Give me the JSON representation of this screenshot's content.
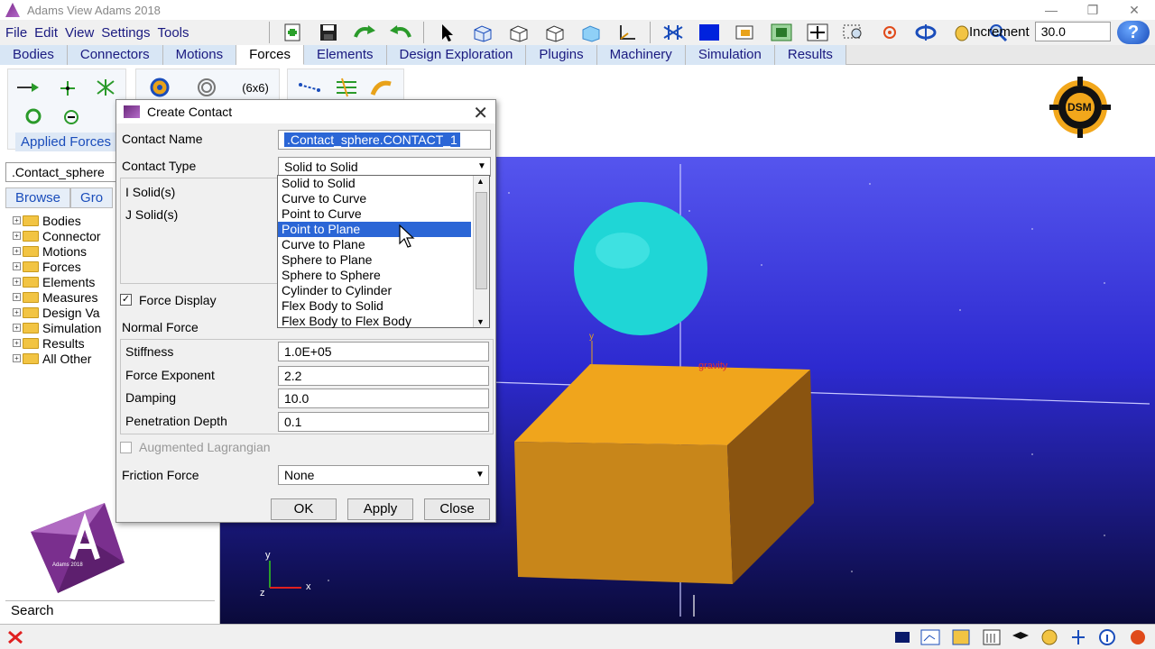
{
  "window": {
    "title": "Adams View Adams 2018"
  },
  "menu": [
    "File",
    "Edit",
    "View",
    "Settings",
    "Tools"
  ],
  "toolbar": {
    "increment_label": "Increment",
    "increment_value": "30.0"
  },
  "tabs": [
    "Bodies",
    "Connectors",
    "Motions",
    "Forces",
    "Elements",
    "Design Exploration",
    "Plugins",
    "Machinery",
    "Simulation",
    "Results"
  ],
  "active_tab": "Forces",
  "ribbon": {
    "applied_forces_label": "Applied Forces",
    "matrix_label": "(6x6)"
  },
  "browser": {
    "model_field": ".Contact_sphere",
    "tabs": [
      "Browse",
      "Gro"
    ],
    "tree": [
      "Bodies",
      "Connector",
      "Motions",
      "Forces",
      "Elements",
      "Measures",
      "Design Va",
      "Simulation",
      "Results",
      "All Other"
    ],
    "search_label": "Search",
    "badge_text": "Adams 2018"
  },
  "dialog": {
    "title": "Create Contact",
    "contact_name_label": "Contact Name",
    "contact_name_value": ".Contact_sphere.CONTACT_1",
    "contact_type_label": "Contact Type",
    "contact_type_value": "Solid to Solid",
    "i_solid_label": "I Solid(s)",
    "j_solid_label": "J Solid(s)",
    "force_display_label": "Force Display",
    "normal_force_label": "Normal Force",
    "stiffness_label": "Stiffness",
    "stiffness_value": "1.0E+05",
    "force_exponent_label": "Force Exponent",
    "force_exponent_value": "2.2",
    "damping_label": "Damping",
    "damping_value": "10.0",
    "penetration_label": "Penetration Depth",
    "penetration_value": "0.1",
    "augmented_label": "Augmented Lagrangian",
    "friction_label": "Friction Force",
    "friction_value": "None",
    "ok_label": "OK",
    "apply_label": "Apply",
    "close_label": "Close"
  },
  "dropdown": {
    "options": [
      "Solid to Solid",
      "Curve to Curve",
      "Point to Curve",
      "Point to Plane",
      "Curve to Plane",
      "Sphere to Plane",
      "Sphere to Sphere",
      "Cylinder to Cylinder",
      "Flex Body to Solid",
      "Flex Body to Flex Body"
    ],
    "highlighted": "Point to Plane"
  },
  "viewport": {
    "gravity_label": "gravity",
    "axis_y": "y",
    "axis_x": "x",
    "axis_z": "z",
    "sphere_color": "#1fd6d6",
    "box_color": "#e8a21a"
  },
  "logo_text": "DSM"
}
